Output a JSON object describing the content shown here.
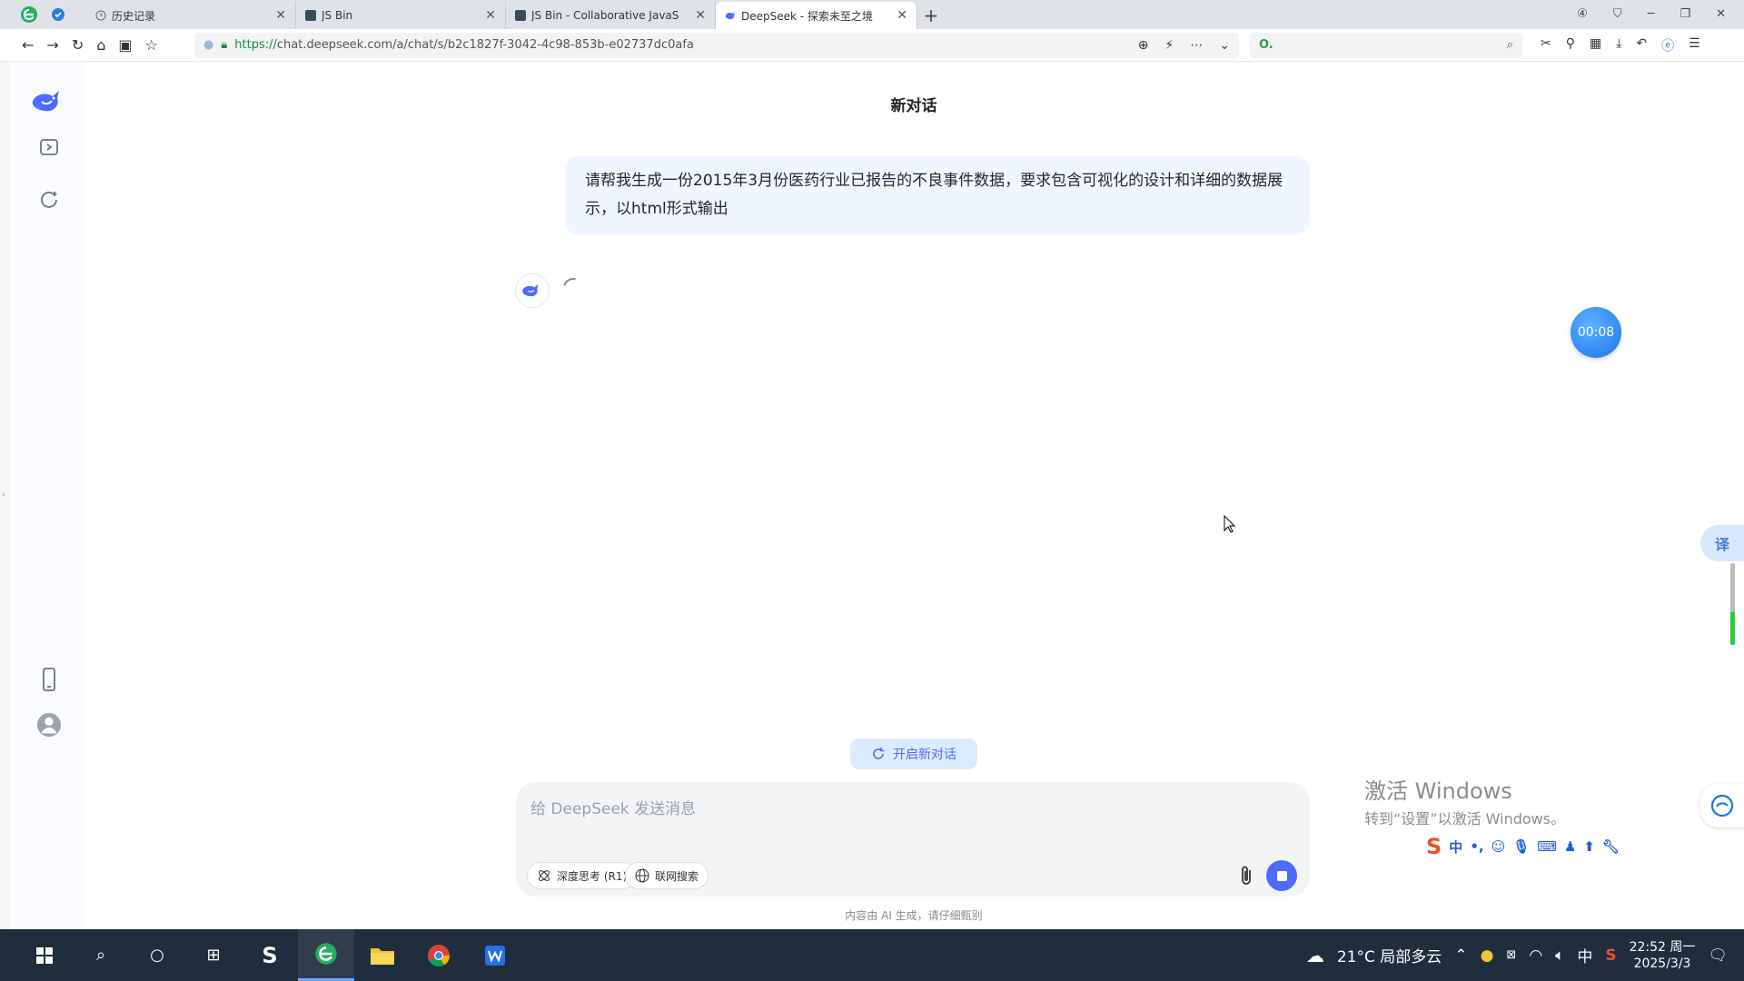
{
  "browser": {
    "tabs": [
      {
        "title": "历史记录"
      },
      {
        "title": "JS Bin"
      },
      {
        "title": "JS Bin - Collaborative JavaS"
      },
      {
        "title": "DeepSeek - 探索未至之境"
      }
    ],
    "new_tab": "+",
    "window_controls": {
      "minimize": "─",
      "restore": "❐",
      "close": "✕"
    },
    "address": {
      "scheme": "https://",
      "rest": "chat.deepseek.com/a/chat/s/b2c1827f-3042-4c98-853b-e02737dc0afa"
    },
    "search_text": "O."
  },
  "chat": {
    "title": "新对话",
    "user_message": "请帮我生成一份2015年3月份医药行业已报告的不良事件数据，要求包含可视化的设计和详细的数据展示，以html形式输出",
    "timer": "00:08",
    "translate_label": "译",
    "new_chat_label": "开启新对话",
    "composer": {
      "placeholder": "给 DeepSeek 发送消息",
      "deep_think": "深度思考 (R1)",
      "web_search": "联网搜索"
    },
    "disclaimer": "内容由 AI 生成，请仔细甄别"
  },
  "watermark": {
    "line1": "激活 Windows",
    "line2": "转到“设置”以激活 Windows。"
  },
  "ime": {
    "logo": "S",
    "mode": "中"
  },
  "taskbar": {
    "weather": "21°C 局部多云",
    "input_mode": "中",
    "time": "22:52 周一",
    "date": "2025/3/3"
  }
}
